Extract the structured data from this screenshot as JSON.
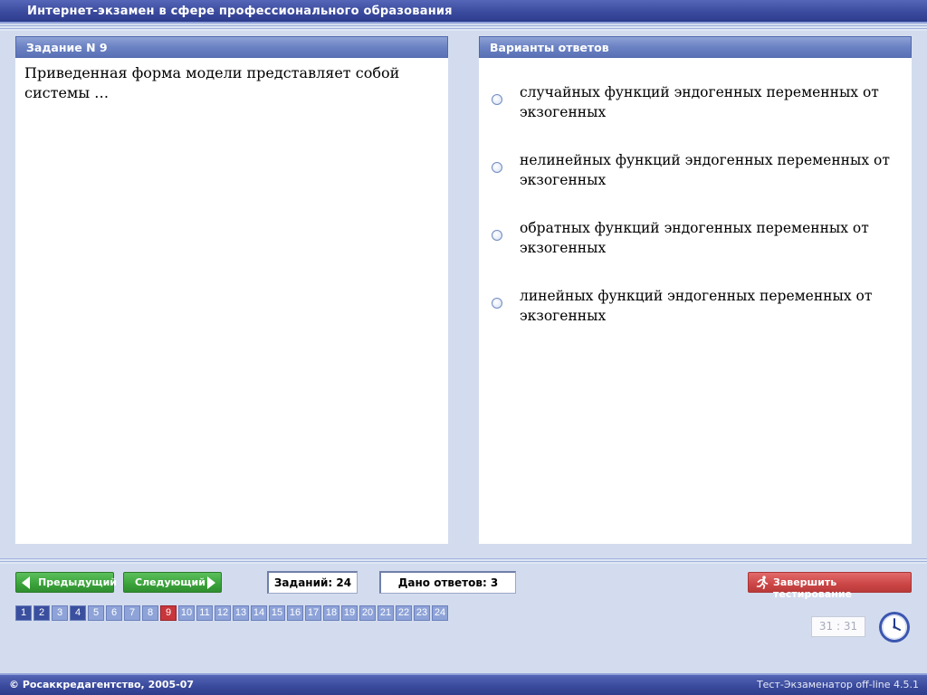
{
  "app": {
    "title": "Интернет-экзамен в сфере профессионального образования"
  },
  "question_panel": {
    "header": "Задание N 9",
    "text": "Приведенная форма модели представляет собой системы …"
  },
  "answers_panel": {
    "header": "Варианты ответов",
    "options": [
      {
        "label": "случайных функций эндогенных переменных от экзогенных",
        "selected": false
      },
      {
        "label": "нелинейных функций эндогенных переменных от экзогенных",
        "selected": false
      },
      {
        "label": "обратных функций эндогенных переменных от экзогенных",
        "selected": false
      },
      {
        "label": "линейных функций эндогенных переменных от экзогенных",
        "selected": false
      }
    ]
  },
  "controls": {
    "prev_label": "Предыдущий",
    "next_label": "Следующий",
    "tasks_count": "Заданий: 24",
    "answered_count": "Дано ответов: 3",
    "finish_label": "Завершить тестирование"
  },
  "navigation": {
    "items": [
      {
        "num": "1",
        "state": "answered"
      },
      {
        "num": "2",
        "state": "answered"
      },
      {
        "num": "3",
        "state": "unanswered"
      },
      {
        "num": "4",
        "state": "answered"
      },
      {
        "num": "5",
        "state": "unanswered"
      },
      {
        "num": "6",
        "state": "unanswered"
      },
      {
        "num": "7",
        "state": "unanswered"
      },
      {
        "num": "8",
        "state": "unanswered"
      },
      {
        "num": "9",
        "state": "current"
      },
      {
        "num": "10",
        "state": "unanswered"
      },
      {
        "num": "11",
        "state": "unanswered"
      },
      {
        "num": "12",
        "state": "unanswered"
      },
      {
        "num": "13",
        "state": "unanswered"
      },
      {
        "num": "14",
        "state": "unanswered"
      },
      {
        "num": "15",
        "state": "unanswered"
      },
      {
        "num": "16",
        "state": "unanswered"
      },
      {
        "num": "17",
        "state": "unanswered"
      },
      {
        "num": "18",
        "state": "unanswered"
      },
      {
        "num": "19",
        "state": "unanswered"
      },
      {
        "num": "20",
        "state": "unanswered"
      },
      {
        "num": "21",
        "state": "unanswered"
      },
      {
        "num": "22",
        "state": "unanswered"
      },
      {
        "num": "23",
        "state": "unanswered"
      },
      {
        "num": "24",
        "state": "unanswered"
      }
    ],
    "colors": {
      "answered": "#3a4f9e",
      "unanswered": "#8ea3d8",
      "current": "#c8363b"
    }
  },
  "timer": {
    "value": "31 : 31"
  },
  "footer": {
    "copyright": "© Росаккредагентство, 2005-07",
    "version": "Тест-Экзаменатор off-line 4.5.1"
  },
  "icons": {
    "prev": "arrow-left-icon",
    "next": "arrow-right-icon",
    "finish": "running-man-icon",
    "clock": "clock-icon"
  },
  "theme": {
    "titlebar": "#3b4a9e",
    "background": "#d3dcee",
    "green_button": "#3aa23a",
    "red_button": "#cc4646"
  }
}
